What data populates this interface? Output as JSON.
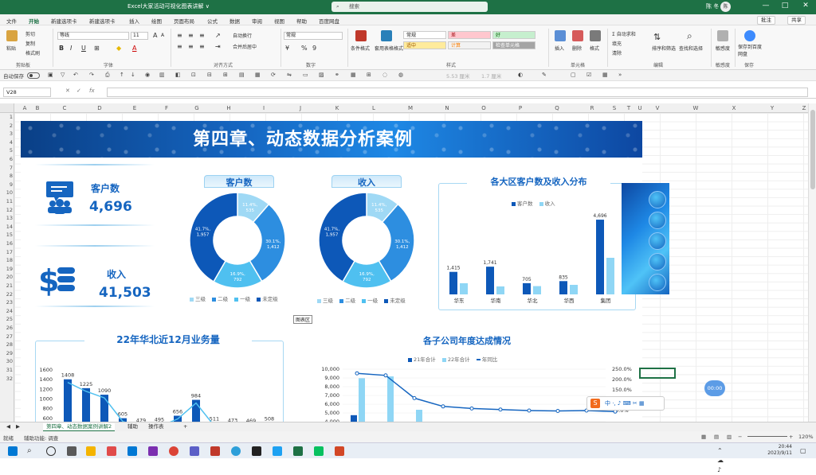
{
  "titlebar": {
    "doc_title": "Excel大家活动可视化图表讲解 ∨",
    "search_placeholder": "搜索",
    "user": "陈 冬",
    "avatar": "陈",
    "min": "—",
    "max": "□",
    "close": "✕"
  },
  "ribbon_tabs": [
    "文件",
    "开始",
    "新建选项卡",
    "新建选项卡",
    "插入",
    "绘图",
    "页面布局",
    "公式",
    "数据",
    "审阅",
    "视图",
    "帮助",
    "百度网盘"
  ],
  "ribbon_actions": {
    "comment": "批注",
    "share": "共享"
  },
  "ribbon": {
    "clipboard": {
      "paste": "粘贴",
      "cut": "剪切",
      "copy": "复制",
      "format_painter": "格式刷",
      "label": "剪贴板"
    },
    "font": {
      "name": "等线",
      "size": "11",
      "label": "字体",
      "bold": "B",
      "italic": "I",
      "underline": "U",
      "grow": "A",
      "shrink": "A"
    },
    "alignment": {
      "wrap": "自动换行",
      "merge": "合并后居中",
      "label": "对齐方式"
    },
    "number": {
      "format": "常规",
      "percent": "%",
      "comma": "9",
      "label": "数字"
    },
    "styles": {
      "conditional": "条件格式",
      "table": "套用表格格式",
      "normal": "常规",
      "bad": "差",
      "good": "好",
      "neutral": "适中",
      "calc": "计算",
      "check": "检查单元格",
      "label": "样式"
    },
    "cells": {
      "insert": "插入",
      "delete": "删除",
      "format": "格式",
      "label": "单元格"
    },
    "editing": {
      "autosum": "自动求和",
      "fill": "填充",
      "clear": "清除",
      "sort": "排序和筛选",
      "find": "查找和选择",
      "label": "编辑"
    },
    "sensitivity": {
      "item": "敏感度",
      "label": "敏感度"
    },
    "save": {
      "item": "保存到百度网盘",
      "label": "保存"
    }
  },
  "qat": {
    "autosave": "自动保存",
    "fontsize_a": "5.53 厘米",
    "fontsize_b": "1.7 厘米"
  },
  "formula_bar": {
    "name_box": "V28",
    "cancel": "✕",
    "enter": "✓",
    "fx": "fx",
    "value": ""
  },
  "columns": [
    "A",
    "B",
    "C",
    "D",
    "E",
    "F",
    "G",
    "H",
    "I",
    "J",
    "K",
    "L",
    "M",
    "N",
    "O",
    "P",
    "Q",
    "R",
    "S",
    "T",
    "U",
    "V",
    "W",
    "X",
    "Y",
    "Z"
  ],
  "rows": [
    "1",
    "2",
    "3",
    "4",
    "5",
    "6",
    "7",
    "8",
    "9",
    "10",
    "11",
    "12",
    "13",
    "14",
    "15",
    "16",
    "17",
    "18",
    "19",
    "20",
    "21",
    "22",
    "23",
    "24",
    "25",
    "26",
    "27",
    "28",
    "29",
    "30",
    "31",
    "32"
  ],
  "dashboard": {
    "title": "第四章、动态数据分析案例",
    "kpi_customers": {
      "label": "客户数",
      "value": "4,696"
    },
    "kpi_revenue": {
      "label": "收入",
      "value": "41,503"
    },
    "donut_customers_title": "客户数",
    "donut_revenue_title": "收入",
    "bar_region_title": "各大区客户数及收入分布",
    "trend_title": "22年华北近12月业务量",
    "combo_title": "各子公司年度达成情况",
    "tooltip": "图表区"
  },
  "chart_data": [
    {
      "type": "pie",
      "title": "客户数",
      "categories": [
        "三级",
        "二级",
        "一级",
        "未定级"
      ],
      "values": [
        535,
        1412,
        792,
        1957
      ],
      "labels": [
        "11.4%, 535",
        "30.1%, 1,412",
        "16.9%, 792",
        "41.7%, 1,957"
      ],
      "colors": [
        "#9fd9f5",
        "#2d8ee0",
        "#4fc0f0",
        "#0d58b8"
      ]
    },
    {
      "type": "pie",
      "title": "收入",
      "categories": [
        "三级",
        "二级",
        "一级",
        "未定级"
      ],
      "values": [
        535,
        1412,
        792,
        1957
      ],
      "labels": [
        "11.4%, 535",
        "30.1%, 1,412",
        "16.9%, 792",
        "41.7%, 1,957"
      ],
      "colors": [
        "#9fd9f5",
        "#2d8ee0",
        "#4fc0f0",
        "#0d58b8"
      ]
    },
    {
      "type": "bar",
      "title": "各大区客户数及收入分布",
      "categories": [
        "华东",
        "华南",
        "华北",
        "华西",
        "集团"
      ],
      "series": [
        {
          "name": "客户数",
          "values": [
            1415,
            1741,
            705,
            835,
            4696
          ],
          "color": "#0d58b8"
        },
        {
          "name": "收入",
          "values": [
            700,
            500,
            520,
            600,
            2300
          ],
          "color": "#8fd6f5"
        }
      ],
      "data_labels": [
        "1,415",
        "1,741",
        "705",
        "835",
        "4,696"
      ],
      "ylim": [
        0,
        5000
      ]
    },
    {
      "type": "bar",
      "title": "22年华北近12月业务量",
      "values": [
        1408,
        1225,
        1090,
        605,
        479,
        495,
        656,
        984,
        511,
        473,
        469,
        508
      ],
      "y_ticks": [
        "1600",
        "1400",
        "1200",
        "1000",
        "800",
        "600"
      ],
      "ylim": [
        500,
        1650
      ],
      "color": "#0d58b8",
      "line_color": "#4fc0f0"
    },
    {
      "type": "bar",
      "title": "各子公司年度达成情况",
      "series": [
        {
          "name": "21年合计",
          "values": [
            4900,
            900,
            2500,
            1400,
            1100,
            700,
            500,
            400,
            900,
            300
          ],
          "color": "#0d58b8"
        },
        {
          "name": "22年合计",
          "values": [
            9000,
            9200,
            5500,
            300,
            900,
            1000,
            800,
            700,
            500,
            200
          ],
          "color": "#8fd6f5"
        },
        {
          "name": "年同比",
          "values": [
            230,
            220,
            110,
            70,
            60,
            55,
            50,
            48,
            50,
            45
          ],
          "type": "line",
          "color": "#1565c0"
        }
      ],
      "y_ticks": [
        "10,000",
        "9,000",
        "8,000",
        "7,000",
        "6,000",
        "5,000",
        "4,000"
      ],
      "y2_ticks": [
        "250.0%",
        "200.0%",
        "150.0%",
        "100.0%",
        "50.0%"
      ],
      "ylim": [
        4000,
        10000
      ]
    }
  ],
  "sheet_tabs": {
    "active": "第四章、动态数据案例讲解2",
    "tab2": "辅助",
    "tab3": "操作表",
    "add": "+"
  },
  "status": {
    "mode": "就绪",
    "accessibility": "辅助功能: 调查",
    "zoom": "120%"
  },
  "timer": "00:00",
  "clock": {
    "time": "20:44",
    "date": "2023/9/11"
  }
}
